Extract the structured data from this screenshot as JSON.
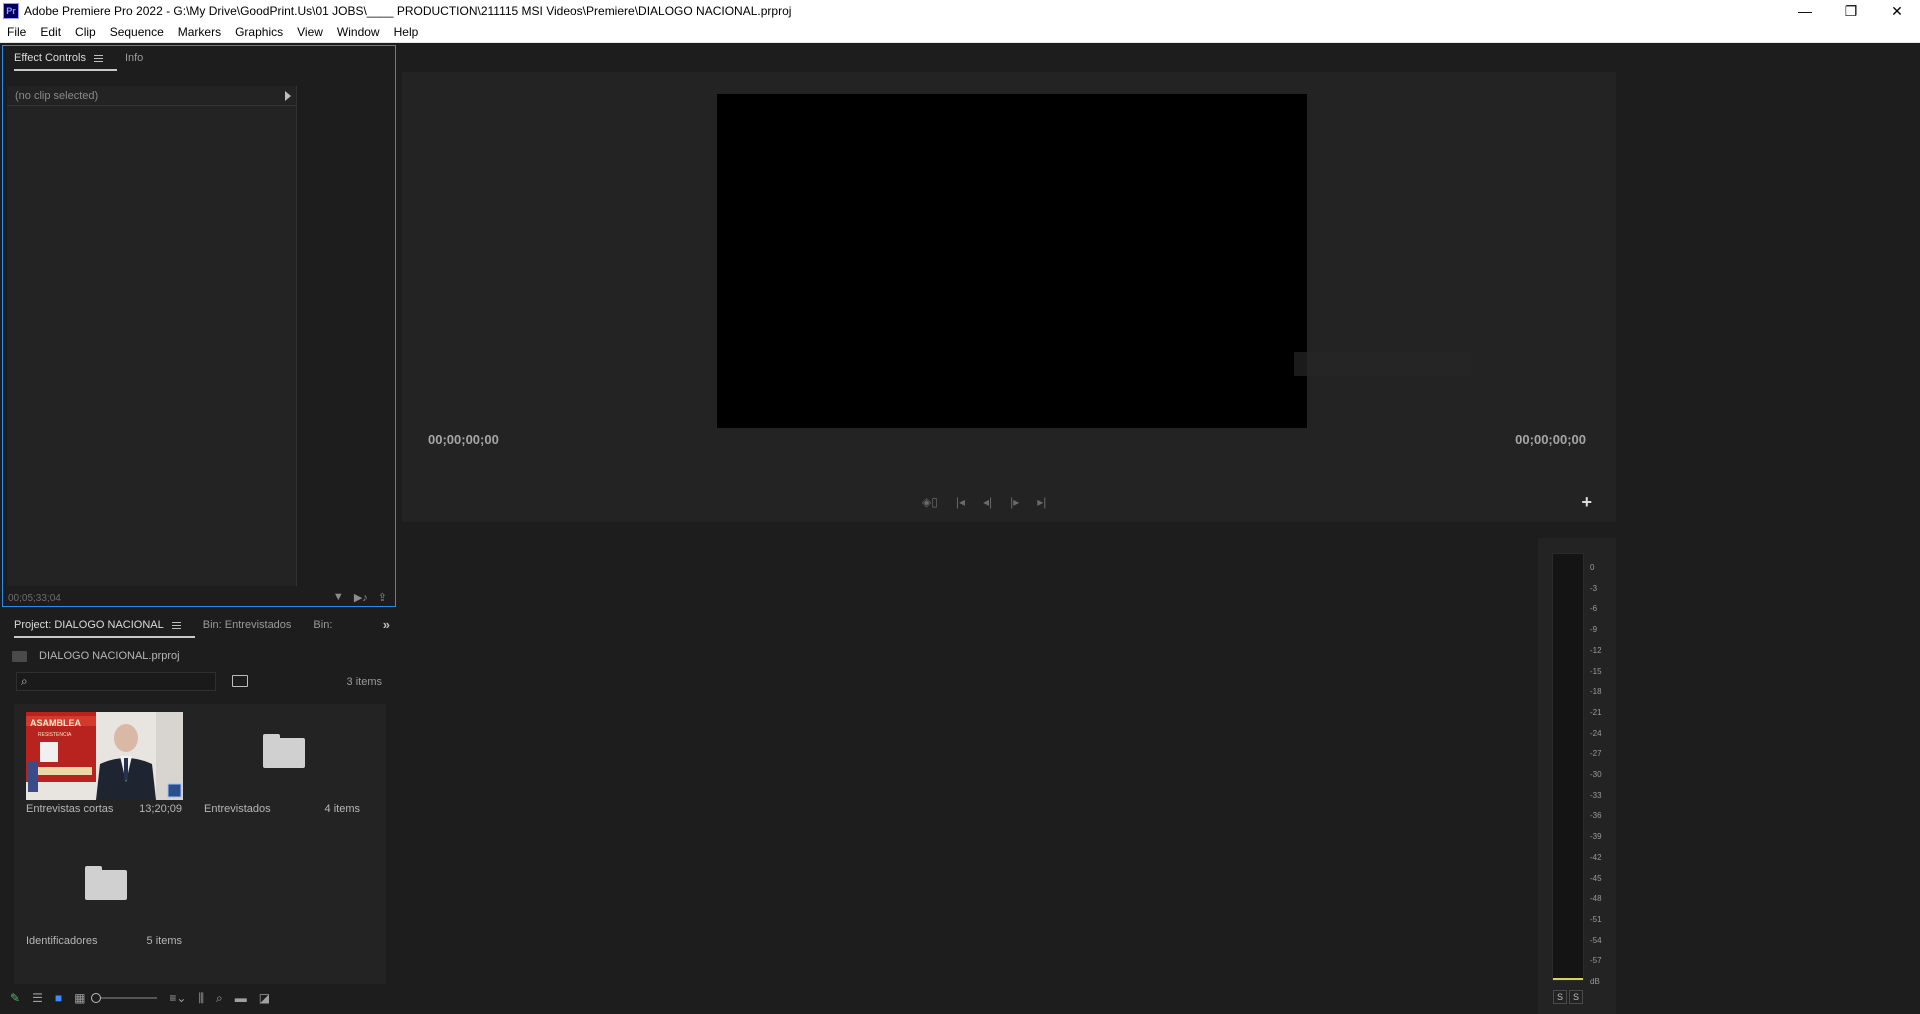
{
  "window": {
    "title": "Adobe Premiere Pro 2022 - G:\\My Drive\\GoodPrint.Us\\01 JOBS\\____ PRODUCTION\\211115 MSI Videos\\Premiere\\DIALOGO NACIONAL.prproj",
    "app_icon_text": "Pr",
    "minimize": "—",
    "restore": "❐",
    "close": "✕"
  },
  "menu": [
    "File",
    "Edit",
    "Clip",
    "Sequence",
    "Markers",
    "Graphics",
    "View",
    "Window",
    "Help"
  ],
  "effect_controls": {
    "tabs": [
      "Effect Controls",
      "Info"
    ],
    "no_clip": "(no clip selected)",
    "timecode": "00;05;33;04"
  },
  "program_monitor": {
    "timecode_left": "00;00;00;00",
    "timecode_right": "00;00;00;00",
    "add_button": "+"
  },
  "project": {
    "tabs": [
      "Project: DIALOGO NACIONAL",
      "Bin: Entrevistados",
      "Bin:"
    ],
    "more_tabs": "»",
    "file_name": "DIALOGO NACIONAL.prproj",
    "search_placeholder": "",
    "item_count": "3 items",
    "items": [
      {
        "label": "Entrevistas cortas",
        "meta": "13;20;09",
        "kind": "sequence"
      },
      {
        "label": "Entrevistados",
        "meta": "4 items",
        "kind": "folder"
      },
      {
        "label": "Identificadores",
        "meta": "5 items",
        "kind": "folder"
      }
    ],
    "thumbnail_text": {
      "banner_top": "ASAMBLEA",
      "banner_bottom": "RESISTENCIA"
    }
  },
  "audio_meter": {
    "scale": [
      "0",
      "-3",
      "-6",
      "-9",
      "-12",
      "-15",
      "-18",
      "-21",
      "-24",
      "-27",
      "-30",
      "-33",
      "-36",
      "-39",
      "-42",
      "-45",
      "-48",
      "-51",
      "-54",
      "-57",
      "dB"
    ],
    "solo_left": "S",
    "solo_right": "S"
  },
  "colors": {
    "panel_bg": "#1d1d1d",
    "monitor_bg": "#232323",
    "focus_border": "#2d8ceb",
    "peak": "#d8d25a"
  }
}
